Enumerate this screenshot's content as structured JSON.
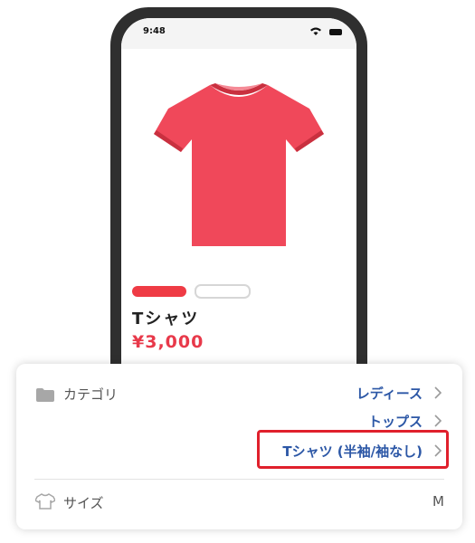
{
  "status_bar": {
    "time": "9:48"
  },
  "product": {
    "name": "Tシャツ",
    "price": "¥3,000",
    "swatches": [
      "red",
      "white"
    ]
  },
  "detail_card": {
    "category_label": "カテゴリ",
    "category_path": [
      "レディース",
      "トップス",
      "Tシャツ (半袖/袖なし)"
    ],
    "size_label": "サイズ",
    "size_value": "M"
  },
  "colors": {
    "accent_red": "#e8394a",
    "link_blue": "#2c57a6",
    "highlight": "#e0202c",
    "phone_frame": "#2f2f2f"
  }
}
